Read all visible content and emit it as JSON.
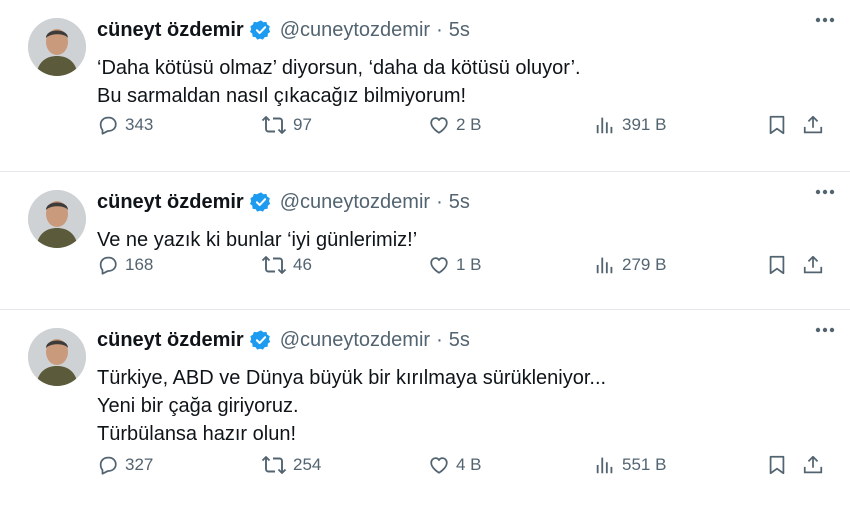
{
  "tweets": [
    {
      "name": "cüneyt özdemir",
      "handle": "@cuneytozdemir",
      "separator": "·",
      "time": "5s",
      "lines": [
        "‘Daha kötüsü olmaz’ diyorsun, ‘daha da kötüsü oluyor’.",
        "Bu sarmaldan nasıl çıkacağız bilmiyorum!"
      ],
      "replies": "343",
      "retweets": "97",
      "likes": "2 B",
      "views": "391 B"
    },
    {
      "name": "cüneyt özdemir",
      "handle": "@cuneytozdemir",
      "separator": "·",
      "time": "5s",
      "lines": [
        "Ve ne yazık ki bunlar ‘iyi günlerimiz!’"
      ],
      "replies": "168",
      "retweets": "46",
      "likes": "1 B",
      "views": "279 B"
    },
    {
      "name": "cüneyt özdemir",
      "handle": "@cuneytozdemir",
      "separator": "·",
      "time": "5s",
      "lines": [
        "Türkiye, ABD ve Dünya büyük bir kırılmaya sürükleniyor...",
        "Yeni bir çağa giriyoruz.",
        "Türbülansa hazır olun!"
      ],
      "replies": "327",
      "retweets": "254",
      "likes": "4 B",
      "views": "551 B"
    }
  ],
  "icons": {
    "reply": "speech-bubble-icon",
    "retweet": "retweet-arrows-icon",
    "like": "heart-icon",
    "views": "bar-chart-icon",
    "bookmark": "bookmark-icon",
    "share": "share-upload-icon",
    "more": "more-dots-icon",
    "verified": "verified-badge-icon"
  },
  "colors": {
    "text": "#0f1419",
    "secondary": "#536471",
    "verified": "#1d9bf0",
    "divider": "#e6e9ec"
  }
}
